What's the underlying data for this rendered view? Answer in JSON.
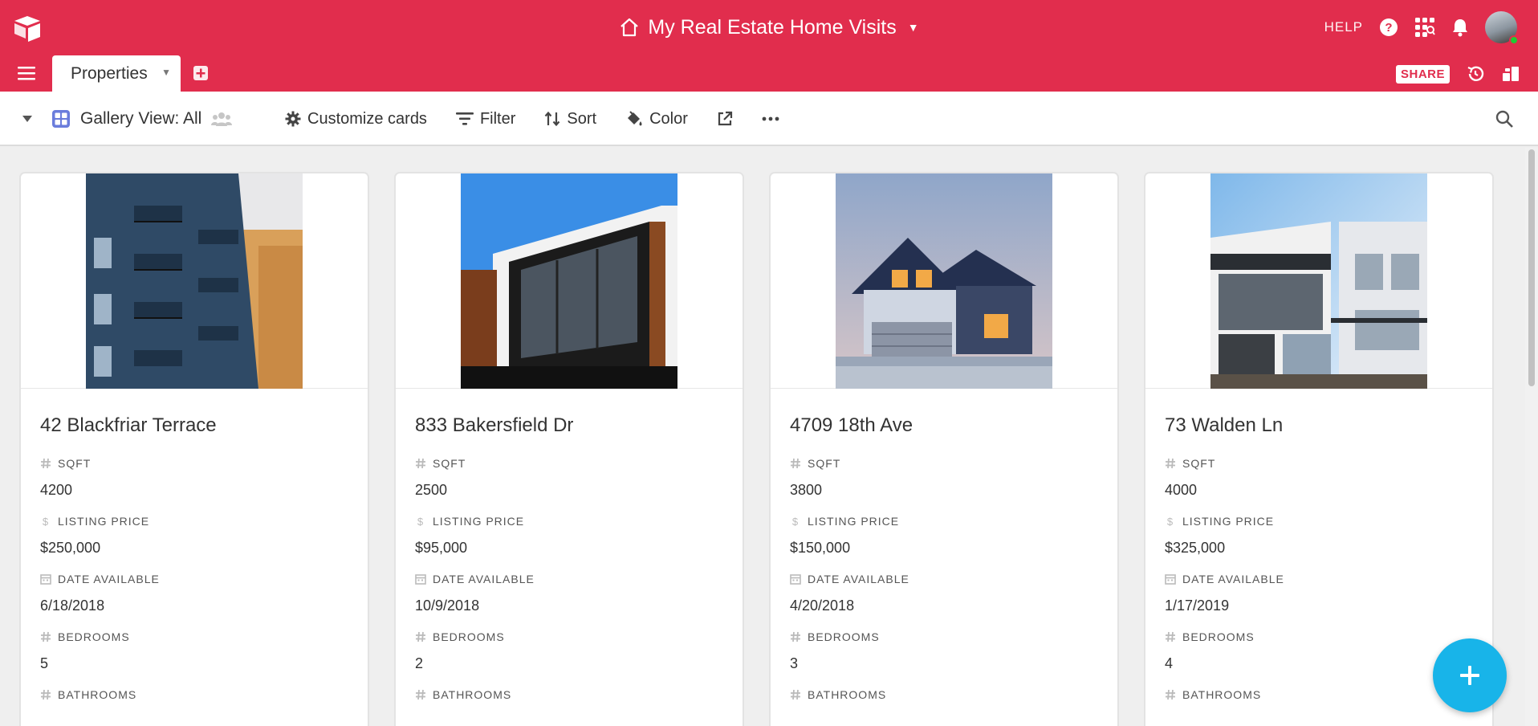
{
  "base": {
    "title": "My Real Estate Home Visits"
  },
  "header": {
    "help_label": "HELP"
  },
  "tables": {
    "active_tab": "Properties",
    "share_label": "SHARE"
  },
  "view": {
    "name": "Gallery View: All",
    "tools": {
      "customize": "Customize cards",
      "filter": "Filter",
      "sort": "Sort",
      "color": "Color"
    }
  },
  "colors": {
    "brand": "#e12d4d",
    "accent": "#18b4e9"
  },
  "cards": [
    {
      "title": "42 Blackfriar Terrace",
      "fields": [
        {
          "label": "SQFT",
          "value": "4200",
          "icon": "number-icon"
        },
        {
          "label": "LISTING PRICE",
          "value": "$250,000",
          "icon": "currency-icon"
        },
        {
          "label": "DATE AVAILABLE",
          "value": "6/18/2018",
          "icon": "calendar-icon"
        },
        {
          "label": "BEDROOMS",
          "value": "5",
          "icon": "number-icon"
        },
        {
          "label": "BATHROOMS",
          "value": "",
          "icon": "number-icon"
        }
      ]
    },
    {
      "title": "833 Bakersfield Dr",
      "fields": [
        {
          "label": "SQFT",
          "value": "2500",
          "icon": "number-icon"
        },
        {
          "label": "LISTING PRICE",
          "value": "$95,000",
          "icon": "currency-icon"
        },
        {
          "label": "DATE AVAILABLE",
          "value": "10/9/2018",
          "icon": "calendar-icon"
        },
        {
          "label": "BEDROOMS",
          "value": "2",
          "icon": "number-icon"
        },
        {
          "label": "BATHROOMS",
          "value": "",
          "icon": "number-icon"
        }
      ]
    },
    {
      "title": "4709 18th Ave",
      "fields": [
        {
          "label": "SQFT",
          "value": "3800",
          "icon": "number-icon"
        },
        {
          "label": "LISTING PRICE",
          "value": "$150,000",
          "icon": "currency-icon"
        },
        {
          "label": "DATE AVAILABLE",
          "value": "4/20/2018",
          "icon": "calendar-icon"
        },
        {
          "label": "BEDROOMS",
          "value": "3",
          "icon": "number-icon"
        },
        {
          "label": "BATHROOMS",
          "value": "",
          "icon": "number-icon"
        }
      ]
    },
    {
      "title": "73 Walden Ln",
      "fields": [
        {
          "label": "SQFT",
          "value": "4000",
          "icon": "number-icon"
        },
        {
          "label": "LISTING PRICE",
          "value": "$325,000",
          "icon": "currency-icon"
        },
        {
          "label": "DATE AVAILABLE",
          "value": "1/17/2019",
          "icon": "calendar-icon"
        },
        {
          "label": "BEDROOMS",
          "value": "4",
          "icon": "number-icon"
        },
        {
          "label": "BATHROOMS",
          "value": "",
          "icon": "number-icon"
        }
      ]
    }
  ]
}
